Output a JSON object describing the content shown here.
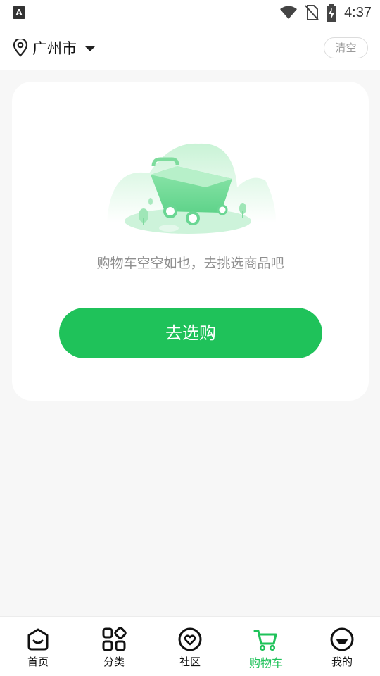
{
  "status_bar": {
    "time": "4:37",
    "left_icon_letter": "A"
  },
  "header": {
    "city": "广州市",
    "clear_label": "清空"
  },
  "cart": {
    "empty_message": "购物车空空如也，去挑选商品吧",
    "go_shopping_label": "去选购"
  },
  "tabbar": {
    "items": [
      {
        "label": "首页",
        "icon": "home-face-icon"
      },
      {
        "label": "分类",
        "icon": "category-grid-icon"
      },
      {
        "label": "社区",
        "icon": "community-heart-icon"
      },
      {
        "label": "购物车",
        "icon": "cart-icon",
        "active": true
      },
      {
        "label": "我的",
        "icon": "profile-face-icon"
      }
    ]
  },
  "colors": {
    "accent": "#1fc25a",
    "background": "#f7f7f7",
    "card": "#ffffff",
    "muted_text": "#8f8f8f"
  }
}
